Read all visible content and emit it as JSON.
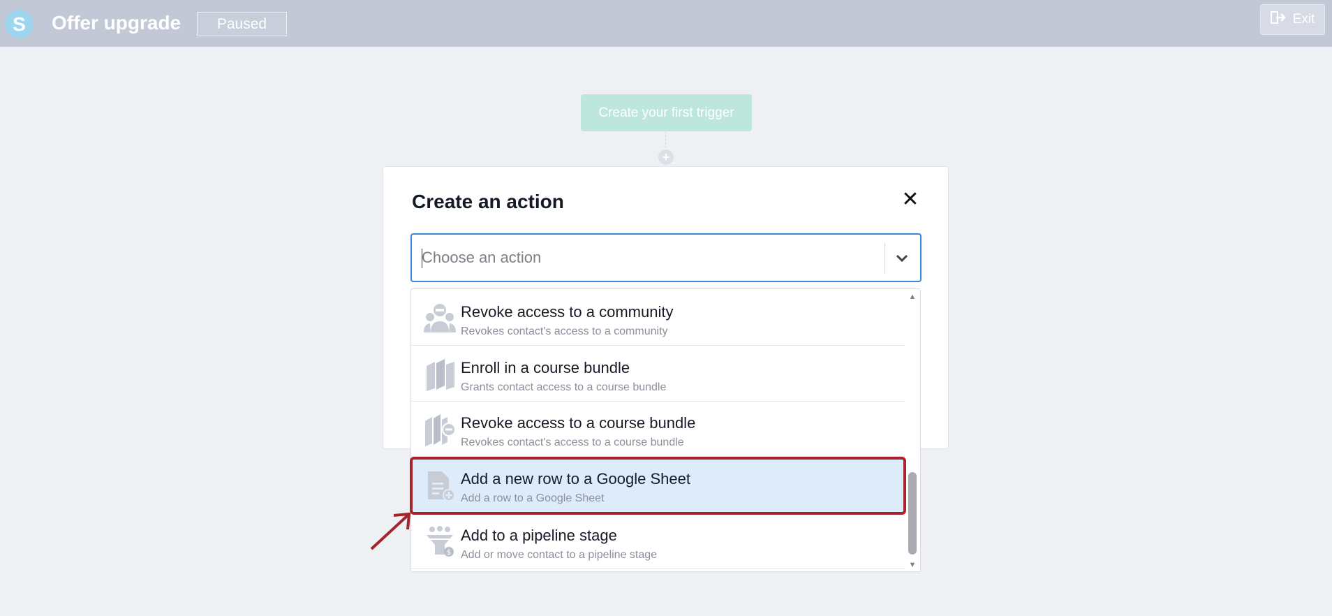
{
  "header": {
    "logo_letter": "S",
    "title": "Offer upgrade",
    "status": "Paused",
    "exit_label": "Exit"
  },
  "canvas": {
    "trigger_label": "Create your first trigger",
    "add_node_label": "+"
  },
  "modal": {
    "title": "Create an action",
    "close_label": "✕",
    "select": {
      "placeholder": "Choose an action",
      "value": ""
    },
    "options": [
      {
        "title": "Revoke access to a community",
        "description": "Revokes contact's access to a community",
        "icon": "community-revoke-icon"
      },
      {
        "title": "Enroll in a course bundle",
        "description": "Grants contact access to a course bundle",
        "icon": "course-bundle-icon"
      },
      {
        "title": "Revoke access to a course bundle",
        "description": "Revokes contact's access to a course bundle",
        "icon": "course-bundle-revoke-icon"
      },
      {
        "title": "Add a new row to a Google Sheet",
        "description": "Add a row to a Google Sheet",
        "icon": "google-sheet-add-icon",
        "selected": true
      },
      {
        "title": "Add to a pipeline stage",
        "description": "Add or move contact to a pipeline stage",
        "icon": "pipeline-stage-icon"
      }
    ]
  },
  "colors": {
    "topbar": "#c3c8d6",
    "accent": "#3a86d8",
    "selected_bg": "#deebfb",
    "annotation": "#a3252b",
    "trigger": "#bde6dc"
  }
}
